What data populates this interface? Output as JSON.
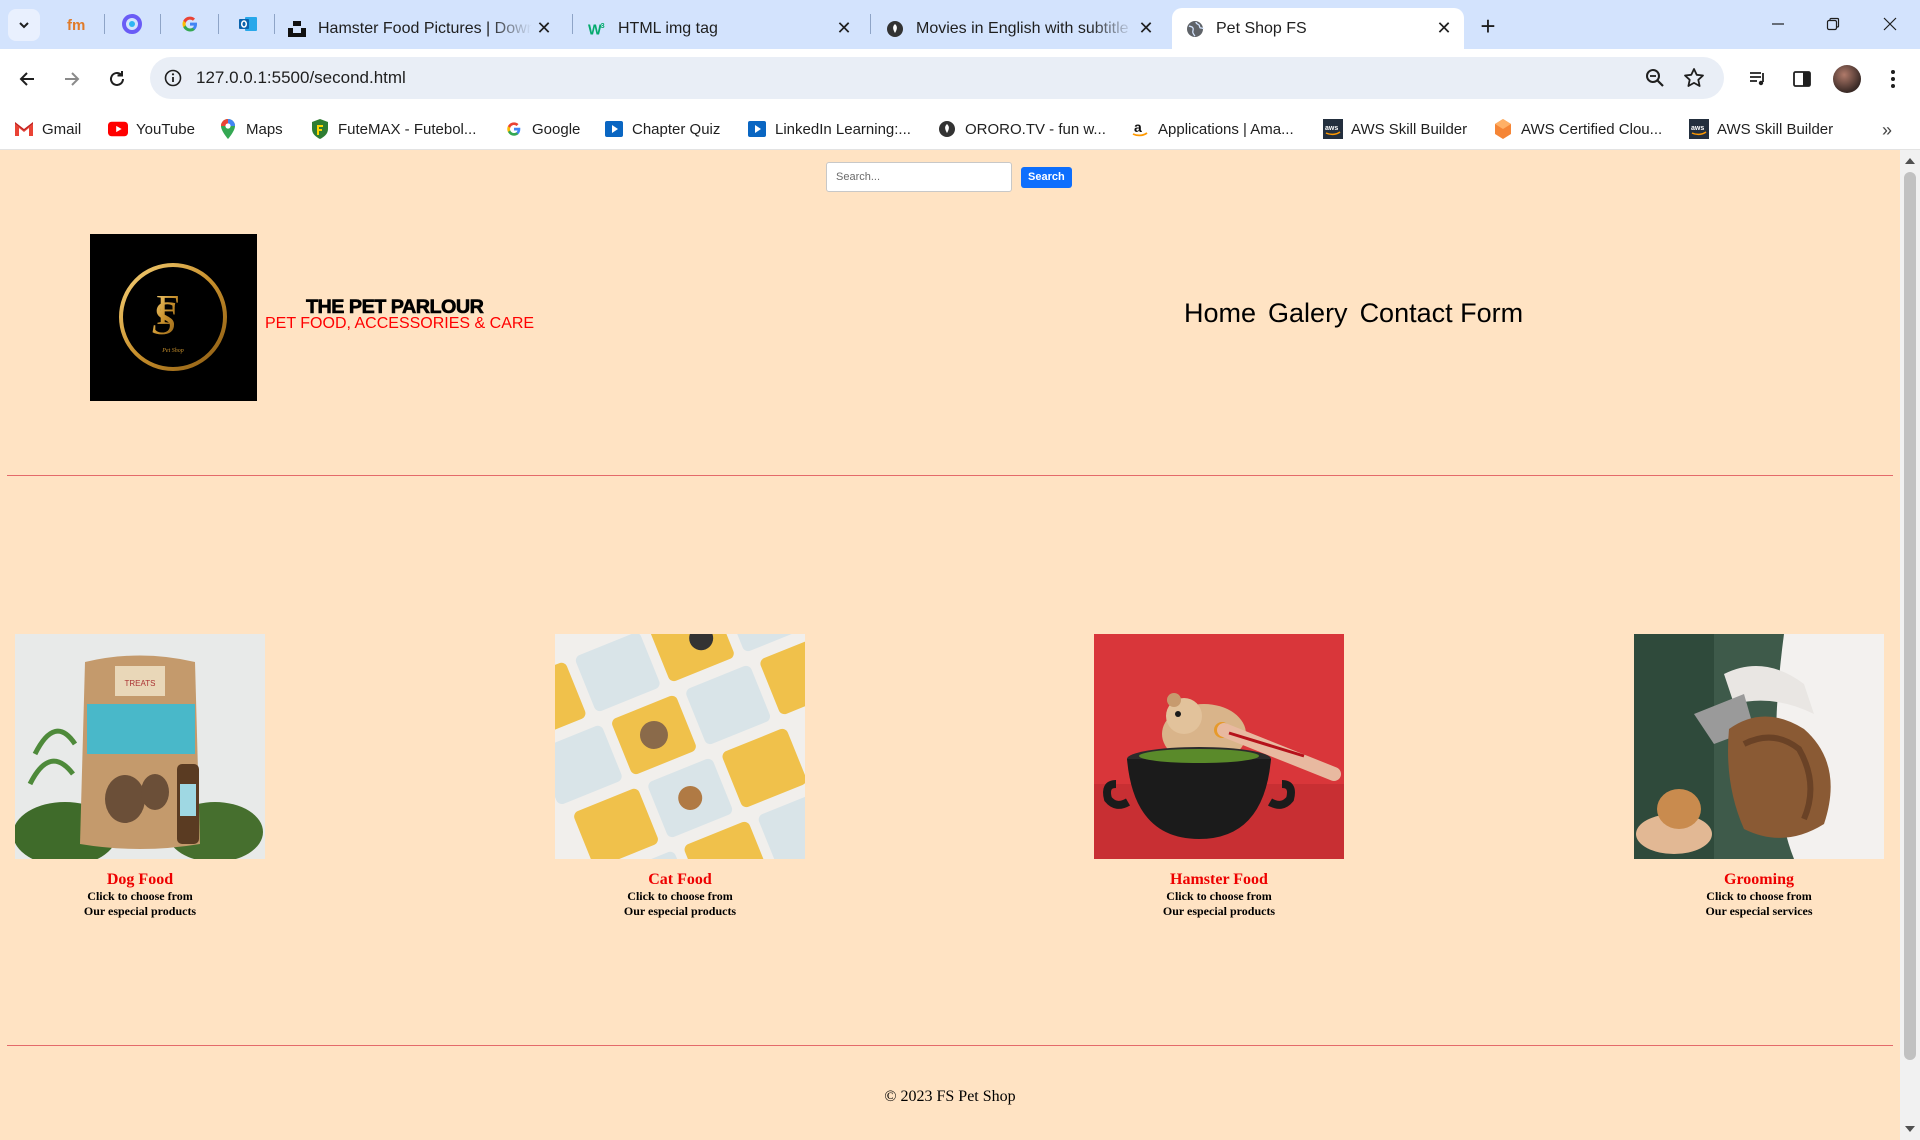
{
  "browser": {
    "tabs": [
      {
        "title": "Hamster Food Pictures | Downl",
        "icon": "unsplash-icon",
        "active": false
      },
      {
        "title": "HTML img tag",
        "icon": "w3-icon",
        "active": false
      },
      {
        "title": "Movies in English with subtitle",
        "icon": "ororo-icon",
        "active": false
      },
      {
        "title": "Pet Shop FS",
        "icon": "globe-icon",
        "active": true
      }
    ],
    "pinned_tabs": [
      "fm-icon",
      "copilot-icon",
      "google-icon",
      "outlook-icon"
    ],
    "url": "127.0.0.1:5500/second.html",
    "bookmarks": [
      {
        "label": "Gmail",
        "icon": "gmail-icon"
      },
      {
        "label": "YouTube",
        "icon": "youtube-icon"
      },
      {
        "label": "Maps",
        "icon": "maps-icon"
      },
      {
        "label": "FuteMAX - Futebol...",
        "icon": "futemax-icon"
      },
      {
        "label": "Google",
        "icon": "google-icon"
      },
      {
        "label": "Chapter Quiz",
        "icon": "quiz-icon"
      },
      {
        "label": "LinkedIn Learning:...",
        "icon": "linkedin-learning-icon"
      },
      {
        "label": "ORORO.TV - fun w...",
        "icon": "ororo-icon"
      },
      {
        "label": "Applications | Ama...",
        "icon": "amazon-icon"
      },
      {
        "label": "AWS Skill Builder",
        "icon": "aws-icon"
      },
      {
        "label": "AWS Certified Clou...",
        "icon": "aws-cert-icon"
      },
      {
        "label": "AWS Skill Builder",
        "icon": "aws-icon"
      }
    ]
  },
  "page": {
    "search": {
      "placeholder": "Search...",
      "button": "Search"
    },
    "logo_text": "Pet Shop",
    "brand": {
      "title": "THE PET PARLOUR",
      "subtitle": "PET FOOD, ACCESSORIES & CARE"
    },
    "nav": [
      "Home",
      "Galery",
      "Contact Form"
    ],
    "cards": [
      {
        "title": "Dog Food",
        "line1": "Click to choose from",
        "line2": "Our especial products"
      },
      {
        "title": "Cat Food",
        "line1": "Click to choose from",
        "line2": "Our especial products"
      },
      {
        "title": "Hamster Food",
        "line1": "Click to choose from",
        "line2": "Our especial products"
      },
      {
        "title": "Grooming",
        "line1": "Click to choose from",
        "line2": "Our especial services"
      }
    ],
    "footer": "© 2023 FS Pet Shop"
  },
  "colors": {
    "page_bg": "#ffe3c3",
    "accent_red": "#ee0000",
    "divider": "#e46a6a",
    "search_button": "#0d6efd"
  }
}
